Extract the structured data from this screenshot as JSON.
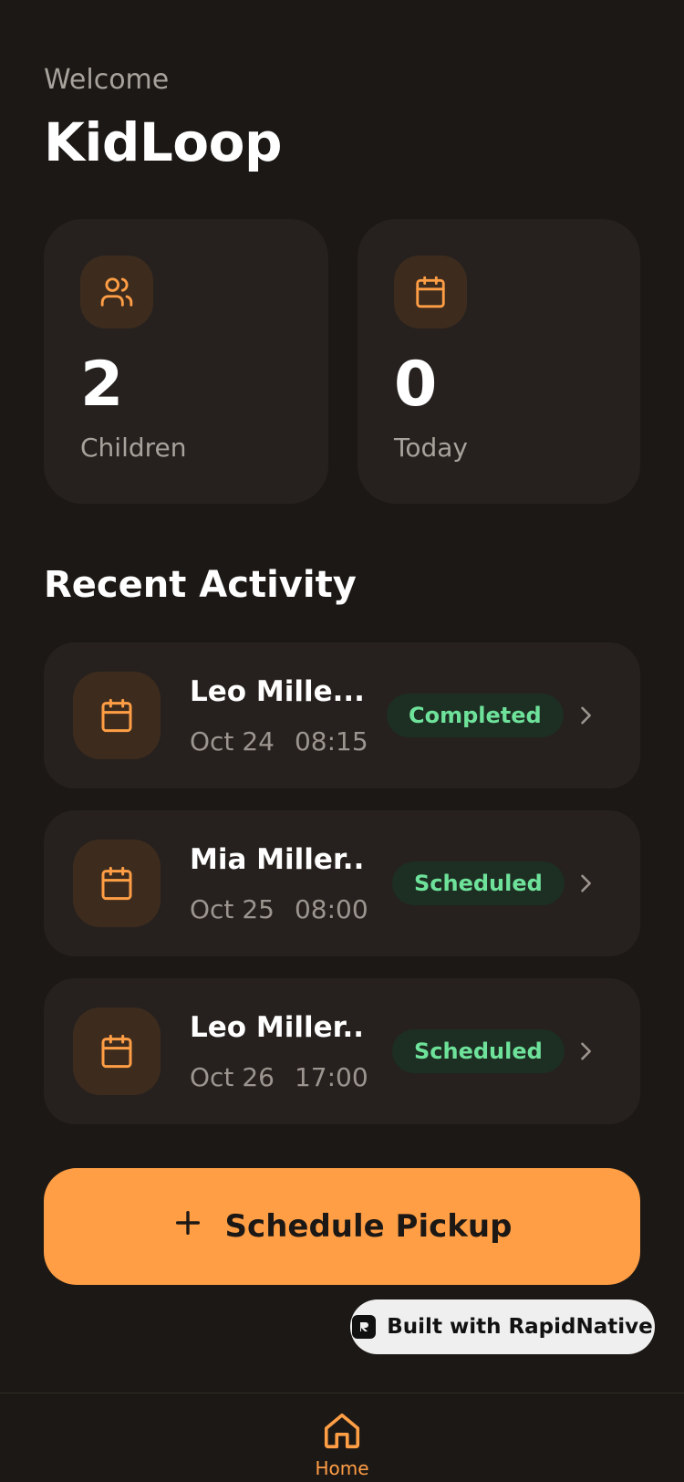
{
  "header": {
    "welcome": "Welcome",
    "title": "KidLoop"
  },
  "stats": [
    {
      "value": "2",
      "label": "Children",
      "icon": "users-icon"
    },
    {
      "value": "0",
      "label": "Today",
      "icon": "calendar-icon"
    }
  ],
  "recent": {
    "title": "Recent Activity",
    "items": [
      {
        "name": "Leo Mille...",
        "date": "Oct 24",
        "time": "08:15",
        "status": "Completed"
      },
      {
        "name": "Mia Miller...",
        "date": "Oct 25",
        "time": "08:00",
        "status": "Scheduled"
      },
      {
        "name": "Leo Miller...",
        "date": "Oct 26",
        "time": "17:00",
        "status": "Scheduled"
      }
    ]
  },
  "cta": {
    "label": "Schedule Pickup"
  },
  "watermark": {
    "label": "Built with RapidNative"
  },
  "tabbar": {
    "home_label": "Home"
  },
  "colors": {
    "accent": "#ff9e45",
    "background": "#1c1815",
    "card": "#26211e",
    "status_green": "#6ee29a"
  }
}
